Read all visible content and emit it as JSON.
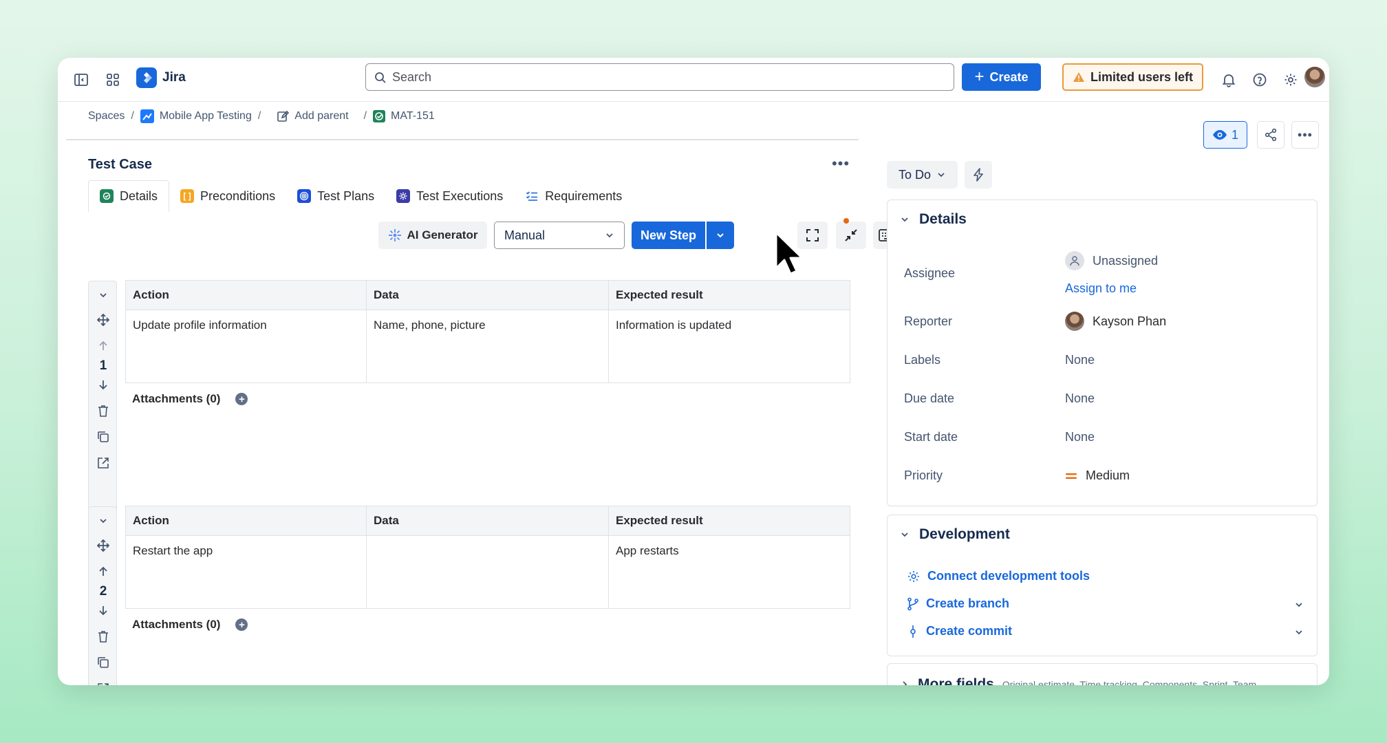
{
  "nav": {
    "app_name": "Jira",
    "search_placeholder": "Search",
    "create_label": "Create",
    "limited_label": "Limited users left"
  },
  "breadcrumb": {
    "spaces": "Spaces",
    "project": "Mobile App Testing",
    "add_parent": "Add parent",
    "issue_key": "MAT-151"
  },
  "issue": {
    "type_title": "Test Case",
    "tabs": [
      {
        "label": "Details"
      },
      {
        "label": "Preconditions"
      },
      {
        "label": "Test Plans"
      },
      {
        "label": "Test Executions"
      },
      {
        "label": "Requirements"
      }
    ],
    "toolbar": {
      "ai_label": "AI Generator",
      "mode_value": "Manual",
      "new_step_label": "New Step"
    },
    "table_headers": {
      "action": "Action",
      "data": "Data",
      "expected": "Expected result"
    },
    "steps": [
      {
        "number": "1",
        "action": "Update profile information",
        "data": "Name, phone, picture",
        "expected": "Information is updated",
        "attachments": "Attachments (0)"
      },
      {
        "number": "2",
        "action": "Restart the app",
        "data": "",
        "expected": "App restarts",
        "attachments": "Attachments (0)"
      }
    ]
  },
  "sidebar": {
    "watch_count": "1",
    "status": "To Do",
    "details": {
      "heading": "Details",
      "fields": {
        "assignee_label": "Assignee",
        "assignee_value": "Unassigned",
        "assign_to_me": "Assign to me",
        "reporter_label": "Reporter",
        "reporter_value": "Kayson Phan",
        "labels_label": "Labels",
        "labels_value": "None",
        "due_label": "Due date",
        "due_value": "None",
        "start_label": "Start date",
        "start_value": "None",
        "priority_label": "Priority",
        "priority_value": "Medium"
      }
    },
    "development": {
      "heading": "Development",
      "connect": "Connect development tools",
      "branch": "Create branch",
      "commit": "Create commit"
    },
    "more_fields": {
      "heading": "More fields",
      "hint": "Original estimate, Time tracking, Components, Sprint, Team"
    }
  },
  "colors": {
    "brand": "#1868db",
    "warning": "#e89a3c",
    "priority_medium": "#e56910"
  }
}
